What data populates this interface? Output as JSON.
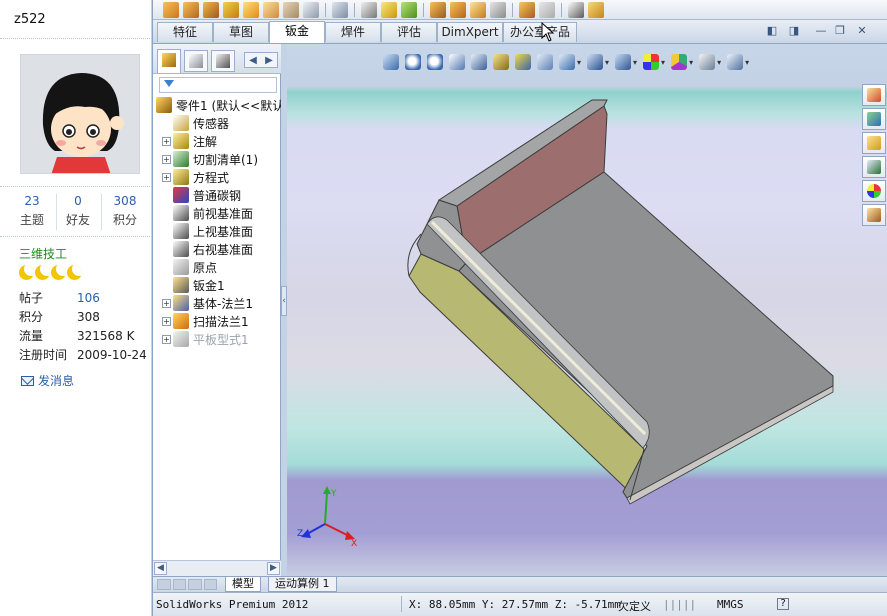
{
  "profile": {
    "username": "z522",
    "stats": [
      {
        "value": "23",
        "label": "主题"
      },
      {
        "value": "0",
        "label": "好友"
      },
      {
        "value": "308",
        "label": "积分"
      }
    ],
    "rank": "三维技工",
    "star_count": 4,
    "info": [
      {
        "key": "帖子",
        "value": "106",
        "link": true
      },
      {
        "key": "积分",
        "value": "308",
        "link": false
      },
      {
        "key": "流量",
        "value": "321568 K",
        "link": false
      },
      {
        "key": "注册时间",
        "value": "2009-10-24",
        "link": false
      }
    ],
    "send_message": "发消息"
  },
  "command_tabs": [
    "特征",
    "草图",
    "钣金",
    "焊件",
    "评估",
    "DimXpert",
    "办公室产品"
  ],
  "active_command_tab": "钣金",
  "feature_tree": {
    "root": "零件1  (默认<<默认",
    "items": [
      {
        "label": "传感器",
        "expandable": false,
        "dim": false
      },
      {
        "label": "注解",
        "expandable": true,
        "dim": false
      },
      {
        "label": "切割清单(1)",
        "expandable": true,
        "dim": false
      },
      {
        "label": "方程式",
        "expandable": true,
        "dim": false
      },
      {
        "label": "普通碳钢",
        "expandable": false,
        "dim": false
      },
      {
        "label": "前视基准面",
        "expandable": false,
        "dim": false
      },
      {
        "label": "上视基准面",
        "expandable": false,
        "dim": false
      },
      {
        "label": "右视基准面",
        "expandable": false,
        "dim": false
      },
      {
        "label": "原点",
        "expandable": false,
        "dim": false
      },
      {
        "label": "钣金1",
        "expandable": false,
        "dim": false
      },
      {
        "label": "基体-法兰1",
        "expandable": true,
        "dim": false
      },
      {
        "label": "扫描法兰1",
        "expandable": true,
        "dim": false
      },
      {
        "label": "平板型式1",
        "expandable": true,
        "dim": true
      }
    ]
  },
  "bottom_tabs": [
    "模型",
    "运动算例 1"
  ],
  "status": {
    "app": "SolidWorks Premium 2012",
    "coords": "X: 88.05mm Y: 27.57mm Z: -5.71mm",
    "state": "欠定义",
    "units": "MMGS",
    "help": "?"
  },
  "triad": {
    "x": "X",
    "y": "Y",
    "z": "Z"
  },
  "colors": {
    "accent": "#2a5fa8",
    "rank": "#1f8a20",
    "part_face_top": "#8f9092",
    "part_face_side": "#b7b872",
    "part_inner_wall": "#9c6e6e"
  }
}
